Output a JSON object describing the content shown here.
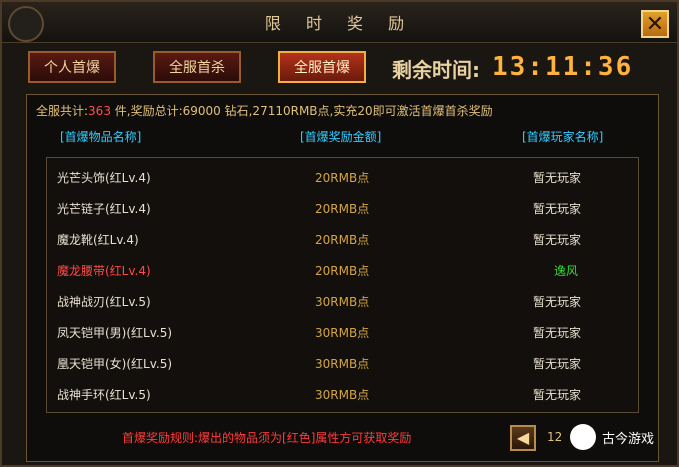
{
  "window": {
    "title": "限 时 奖 励"
  },
  "tabs": [
    {
      "label": "个人首爆",
      "active": false
    },
    {
      "label": "全服首杀",
      "active": false
    },
    {
      "label": "全服首爆",
      "active": true
    }
  ],
  "timer": {
    "label": "剩余时间:",
    "value": "13:11:36"
  },
  "summary": {
    "p1": "全服共计:",
    "count": "363",
    "p2": " 件,奖励总计:69000 钻石,27110RMB点,实充20即可激活首爆首杀奖励"
  },
  "columns": [
    "[首爆物品名称]",
    "[首爆奖励金额]",
    "[首爆玩家名称]"
  ],
  "rows": [
    {
      "item": "光芒头饰(红Lv.4)",
      "reward": "20RMB点",
      "player": "暂无玩家",
      "highlight": false
    },
    {
      "item": "光芒链子(红Lv.4)",
      "reward": "20RMB点",
      "player": "暂无玩家",
      "highlight": false
    },
    {
      "item": "魔龙靴(红Lv.4)",
      "reward": "20RMB点",
      "player": "暂无玩家",
      "highlight": false
    },
    {
      "item": "魔龙腰带(红Lv.4)",
      "reward": "20RMB点",
      "player": "逸风",
      "highlight": true
    },
    {
      "item": "战神战刃(红Lv.5)",
      "reward": "30RMB点",
      "player": "暂无玩家",
      "highlight": false
    },
    {
      "item": "凤天铠甲(男)(红Lv.5)",
      "reward": "30RMB点",
      "player": "暂无玩家",
      "highlight": false
    },
    {
      "item": "凰天铠甲(女)(红Lv.5)",
      "reward": "30RMB点",
      "player": "暂无玩家",
      "highlight": false
    },
    {
      "item": "战神手环(红Lv.5)",
      "reward": "30RMB点",
      "player": "暂无玩家",
      "highlight": false
    }
  ],
  "footer": {
    "rule": "首爆奖励规则:爆出的物品须为[红色]属性方可获取奖励",
    "page": "12",
    "prev_icon": "left-arrow-icon"
  },
  "watermark": {
    "text": "古今游戏"
  },
  "colors": {
    "highlight_item": "#ff4a4a",
    "highlight_player": "#33dd33"
  }
}
